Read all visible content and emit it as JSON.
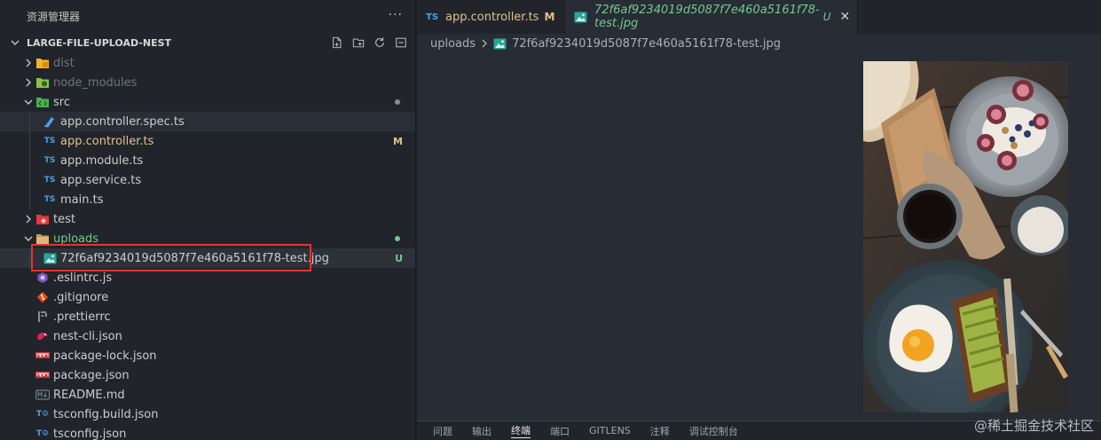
{
  "explorer": {
    "title": "资源管理器",
    "more": "···",
    "project": "LARGE-FILE-UPLOAD-NEST"
  },
  "tree": [
    {
      "name": "dist",
      "depth": 0,
      "type": "folder",
      "open": false,
      "state": "dim",
      "icon": "folder-dist-icon"
    },
    {
      "name": "node_modules",
      "depth": 0,
      "type": "folder",
      "open": false,
      "state": "dim",
      "icon": "folder-node-icon"
    },
    {
      "name": "src",
      "depth": 0,
      "type": "folder",
      "open": true,
      "state": "normal",
      "icon": "folder-src-icon",
      "dot": "#8c8c8c"
    },
    {
      "name": "app.controller.spec.ts",
      "depth": 1,
      "type": "file",
      "state": "hover",
      "icon": "test-spec-icon"
    },
    {
      "name": "app.controller.ts",
      "depth": 1,
      "type": "file",
      "state": "modified",
      "icon": "ts-icon",
      "badge": "M"
    },
    {
      "name": "app.module.ts",
      "depth": 1,
      "type": "file",
      "state": "normal",
      "icon": "ts-icon"
    },
    {
      "name": "app.service.ts",
      "depth": 1,
      "type": "file",
      "state": "normal",
      "icon": "ts-icon"
    },
    {
      "name": "main.ts",
      "depth": 1,
      "type": "file",
      "state": "normal",
      "icon": "ts-icon"
    },
    {
      "name": "test",
      "depth": 0,
      "type": "folder",
      "open": false,
      "state": "normal",
      "icon": "folder-test-icon"
    },
    {
      "name": "uploads",
      "depth": 0,
      "type": "folder",
      "open": true,
      "state": "untracked",
      "icon": "folder-icon",
      "dot": "#73c991"
    },
    {
      "name": "72f6af9234019d5087f7e460a5161f78-test.jpg",
      "depth": 1,
      "type": "file",
      "state": "selected",
      "icon": "image-icon",
      "badge": "U"
    },
    {
      "name": ".eslintrc.js",
      "depth": 0,
      "type": "file",
      "state": "normal",
      "icon": "eslint-icon"
    },
    {
      "name": ".gitignore",
      "depth": 0,
      "type": "file",
      "state": "normal",
      "icon": "git-icon"
    },
    {
      "name": ".prettierrc",
      "depth": 0,
      "type": "file",
      "state": "normal",
      "icon": "prettier-icon"
    },
    {
      "name": "nest-cli.json",
      "depth": 0,
      "type": "file",
      "state": "normal",
      "icon": "nest-icon"
    },
    {
      "name": "package-lock.json",
      "depth": 0,
      "type": "file",
      "state": "normal",
      "icon": "npm-icon"
    },
    {
      "name": "package.json",
      "depth": 0,
      "type": "file",
      "state": "normal",
      "icon": "npm-icon"
    },
    {
      "name": "README.md",
      "depth": 0,
      "type": "file",
      "state": "normal",
      "icon": "markdown-icon"
    },
    {
      "name": "tsconfig.build.json",
      "depth": 0,
      "type": "file",
      "state": "normal",
      "icon": "tsconfig-icon"
    },
    {
      "name": "tsconfig.json",
      "depth": 0,
      "type": "file",
      "state": "normal",
      "icon": "tsconfig-icon"
    }
  ],
  "tabs": {
    "inactive": {
      "ts": "TS",
      "label": "app.controller.ts",
      "status": "M"
    },
    "active": {
      "label": "72f6af9234019d5087f7e460a5161f78-test.jpg",
      "status": "U",
      "close": "✕"
    }
  },
  "breadcrumb": {
    "folder": "uploads",
    "file": "72f6af9234019d5087f7e460a5161f78-test.jpg"
  },
  "panel": {
    "tabs": [
      "问题",
      "输出",
      "终端",
      "端口",
      "GITLENS",
      "注释",
      "调试控制台"
    ],
    "active_index": 2
  },
  "watermark": "@稀土掘金技术社区",
  "colors": {
    "modified": "#e2c08d",
    "untracked": "#73c991",
    "ts_blue": "#4d9fe4",
    "highlight_box": "#e5342c"
  }
}
